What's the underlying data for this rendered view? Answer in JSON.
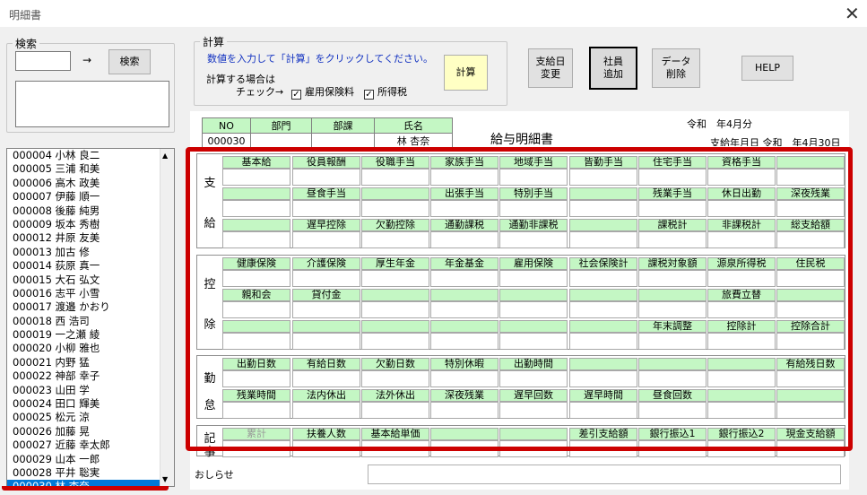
{
  "window": {
    "title": "明細書",
    "close": "✕"
  },
  "search": {
    "legend": "検索",
    "arrow": "→",
    "button": "検索"
  },
  "calc": {
    "legend": "計算",
    "instruction": "数値を入力して「計算」をクリックしてください。",
    "check_label1": "計算する場合は",
    "check_label2": "チェック→",
    "cb1": "雇用保険料",
    "cb2": "所得税",
    "button": "計算"
  },
  "buttons": {
    "payday": "支給日\n変更",
    "add": "社員\n追加",
    "delete": "データ\n削除",
    "help": "HELP"
  },
  "employees": [
    "000004 小林 良二",
    "000005 三浦 和美",
    "000006 高木 政美",
    "000007 伊藤 順一",
    "000008 後藤 純男",
    "000009 坂本 秀樹",
    "000012 井原 友美",
    "000013 加古 修",
    "000014 荻原 真一",
    "000015 大石 弘文",
    "000016 志平 小雪",
    "000017 渡邉 かおり",
    "000018 西 浩司",
    "000019 一之瀬 綾",
    "000020 小柳 雅也",
    "000021 内野 猛",
    "000022 神部 幸子",
    "000023 山田 学",
    "000024 田口 輝美",
    "000025 松元 涼",
    "000026 加藤 晃",
    "000027 近藤 幸太郎",
    "000029 山本 一郎",
    "000028 平井 聡実",
    "000030 林 杏奈"
  ],
  "selected_employee": "000030 林 杏奈",
  "header": {
    "no_label": "NO",
    "dept_label": "部門",
    "section_label": "部課",
    "name_label": "氏名",
    "no": "000030",
    "dept": "",
    "section": "",
    "name": "林 杏奈",
    "slip_title": "給与明細書",
    "month": "令和　年4月分",
    "payday": "支給年月日 令和　年4月30日"
  },
  "sections": {
    "pay": {
      "chars": [
        "支",
        "給"
      ],
      "rows": [
        [
          "基本給",
          "役員報酬",
          "役職手当",
          "家族手当",
          "地域手当",
          "皆勤手当",
          "住宅手当",
          "資格手当",
          ""
        ],
        [
          "",
          "昼食手当",
          "",
          "出張手当",
          "特別手当",
          "",
          "残業手当",
          "休日出勤",
          "深夜残業"
        ],
        [
          "",
          "遅早控除",
          "欠勤控除",
          "通勤課税",
          "通勤非課税",
          "",
          "課税計",
          "非課税計",
          "総支給額"
        ]
      ]
    },
    "ded": {
      "chars": [
        "控",
        "除"
      ],
      "rows": [
        [
          "健康保険",
          "介護保険",
          "厚生年金",
          "年金基金",
          "雇用保険",
          "社会保険計",
          "課税対象額",
          "源泉所得税",
          "住民税"
        ],
        [
          "親和会",
          "貸付金",
          "",
          "",
          "",
          "",
          "",
          "旅費立替",
          ""
        ],
        [
          "",
          "",
          "",
          "",
          "",
          "",
          "年末調整",
          "控除計",
          "控除合計"
        ]
      ]
    },
    "att": {
      "chars": [
        "勤",
        "怠"
      ],
      "rows": [
        [
          "出勤日数",
          "有給日数",
          "欠勤日数",
          "特別休暇",
          "出勤時間",
          "",
          "",
          "",
          "有給残日数"
        ],
        [
          "残業時間",
          "法内休出",
          "法外休出",
          "深夜残業",
          "遅早回数",
          "遅早時間",
          "昼食回数",
          "",
          ""
        ]
      ]
    },
    "memo": {
      "chars": [
        "記",
        "事"
      ],
      "rows": [
        [
          "累計",
          "扶養人数",
          "基本給単価",
          "",
          "",
          "差引支給額",
          "銀行振込1",
          "銀行振込2",
          "現金支給額"
        ]
      ]
    }
  },
  "notice_label": "おしらせ",
  "colors": {
    "label_green": "#c4f7c4",
    "highlight_red": "#cc0000",
    "selected_blue": "#0078d7"
  }
}
